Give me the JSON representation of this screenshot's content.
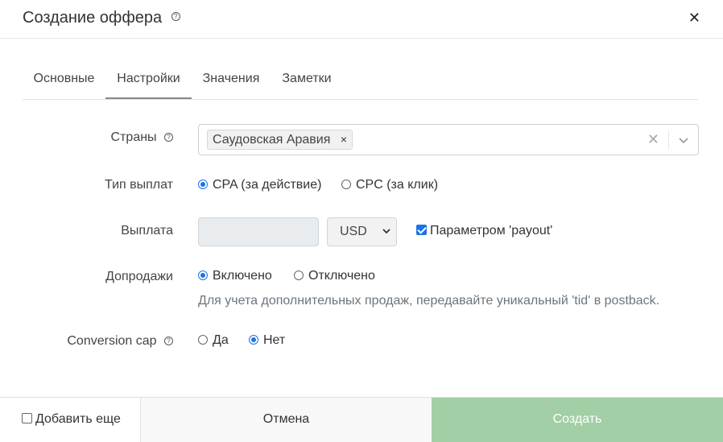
{
  "dialog": {
    "title": "Создание оффера",
    "help_glyph": "?",
    "close_glyph": "✕"
  },
  "tabs": [
    {
      "label": "Основные",
      "active": false
    },
    {
      "label": "Настройки",
      "active": true
    },
    {
      "label": "Значения",
      "active": false
    },
    {
      "label": "Заметки",
      "active": false
    }
  ],
  "countries": {
    "label": "Страны",
    "selected": "Саудовская Аравия",
    "chip_remove": "×",
    "clear_glyph": "✕"
  },
  "payout_type": {
    "label": "Тип выплат",
    "options": [
      {
        "label": "CPA (за действие)",
        "checked": true
      },
      {
        "label": "CPC (за клик)",
        "checked": false
      }
    ]
  },
  "payout": {
    "label": "Выплата",
    "value": "",
    "currency": "USD",
    "param_label": "Параметром 'payout'",
    "param_checked": true
  },
  "upsells": {
    "label": "Допродажи",
    "options": [
      {
        "label": "Включено",
        "checked": true
      },
      {
        "label": "Отключено",
        "checked": false
      }
    ],
    "hint": "Для учета дополнительных продаж, передавайте уникальный 'tid' в postback."
  },
  "conversion_cap": {
    "label": "Conversion cap",
    "options": [
      {
        "label": "Да",
        "checked": false
      },
      {
        "label": "Нет",
        "checked": true
      }
    ]
  },
  "footer": {
    "add_more_label": "Добавить еще",
    "add_more_checked": false,
    "cancel_label": "Отмена",
    "create_label": "Создать"
  },
  "colors": {
    "accent": "#1a73e8",
    "create_button": "#a2cfa5"
  }
}
